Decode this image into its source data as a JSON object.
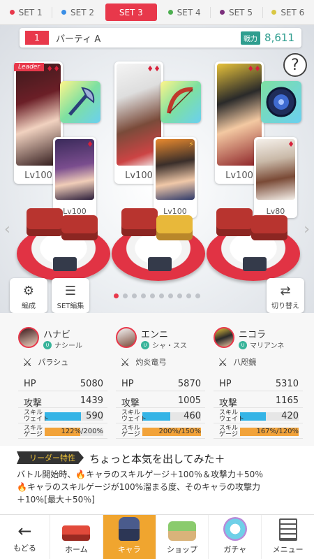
{
  "tabs": [
    {
      "label": "SET 1",
      "color": "#e8384b",
      "active": false
    },
    {
      "label": "SET 2",
      "color": "#3a8ee6",
      "active": false
    },
    {
      "label": "SET 3",
      "color": "#e8384b",
      "active": true
    },
    {
      "label": "SET 4",
      "color": "#4caf50",
      "active": false
    },
    {
      "label": "SET 5",
      "color": "#7b2f7c",
      "active": false
    },
    {
      "label": "SET 6",
      "color": "#d9c743",
      "active": false
    }
  ],
  "party": {
    "number": "1",
    "name": "パーティ A",
    "power_label": "戦力",
    "power_value": "8,611",
    "help_icon": "?"
  },
  "members": [
    {
      "leader_tag": "Leader",
      "main_lv": "Lv100",
      "sub_lv": "Lv100",
      "weapon_icon": "axe-icon"
    },
    {
      "leader_tag": "",
      "main_lv": "Lv100",
      "sub_lv": "Lv100",
      "weapon_icon": "bow-icon"
    },
    {
      "leader_tag": "",
      "main_lv": "Lv100",
      "sub_lv": "Lv80",
      "weapon_icon": "mirror-icon"
    }
  ],
  "side_buttons": {
    "edit": "編成",
    "set_edit": "SET編集",
    "switch": "切り替え"
  },
  "page_dots": {
    "count": 10,
    "active_index": 0
  },
  "characters": [
    {
      "name": "ハナビ",
      "sub": "ナシール",
      "weapon": "パラシュ",
      "hp_label": "HP",
      "hp": "5080",
      "atk_label": "攻撃",
      "atk": "1439",
      "sw_label": "スキル\nウェイト",
      "sw": "590",
      "sw_fill": 0.62,
      "sg_label": "スキル\nゲージ",
      "sg_cur": "122",
      "sg_max": "200",
      "sg_fill": 0.61,
      "sg_text": "122%/200%",
      "sg_hot": false
    },
    {
      "name": "エンニ",
      "sub": "シャ・スス",
      "weapon": "灼炎竜弓",
      "hp_label": "HP",
      "hp": "5870",
      "atk_label": "攻撃",
      "atk": "1005",
      "sw_label": "スキル\nウェイト",
      "sw": "460",
      "sw_fill": 0.48,
      "sg_label": "スキル\nゲージ",
      "sg_cur": "200",
      "sg_max": "150",
      "sg_fill": 1.0,
      "sg_text": "200%/150%",
      "sg_hot": true
    },
    {
      "name": "ニコラ",
      "sub": "マリアンネ",
      "weapon": "八咫鏡",
      "hp_label": "HP",
      "hp": "5310",
      "atk_label": "攻撃",
      "atk": "1165",
      "sw_label": "スキル\nウェイト",
      "sw": "420",
      "sw_fill": 0.44,
      "sg_label": "スキル\nゲージ",
      "sg_cur": "167",
      "sg_max": "120",
      "sg_fill": 1.0,
      "sg_text": "167%/120%",
      "sg_hot": true
    }
  ],
  "leader_skill": {
    "tag": "リーダー特性",
    "title": "ちょっと本気を出してみた＋",
    "line1_pre": "バトル開始時、",
    "line1_post": "キャラのスキルゲージ＋100％＆攻撃力＋50％",
    "line2": "キャラのスキルゲージが100%溜まる度、そのキャラの攻撃力",
    "line3": "＋10％[最大＋50％]"
  },
  "nav": {
    "back": "もどる",
    "items": [
      {
        "label": "ホーム",
        "icon": "home-icon",
        "active": false
      },
      {
        "label": "キャラ",
        "icon": "chara-icon",
        "active": true
      },
      {
        "label": "ショップ",
        "icon": "shop-icon",
        "active": false
      },
      {
        "label": "ガチャ",
        "icon": "gacha-icon",
        "active": false
      },
      {
        "label": "メニュー",
        "icon": "menu-icon",
        "active": false
      }
    ]
  }
}
